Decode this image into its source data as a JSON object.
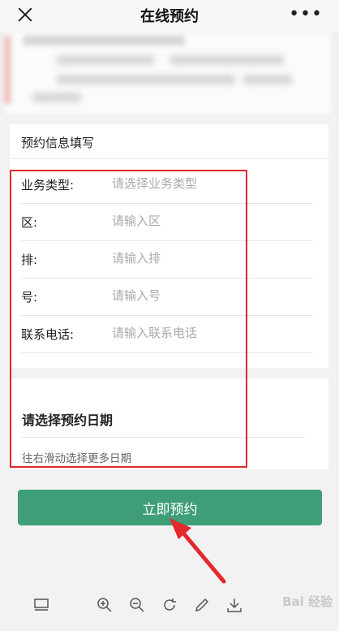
{
  "header": {
    "title": "在线预约"
  },
  "form": {
    "section_title": "预约信息填写",
    "fields": [
      {
        "label": "业务类型:",
        "placeholder": "请选择业务类型",
        "value": ""
      },
      {
        "label": "区:",
        "placeholder": "请输入区",
        "value": ""
      },
      {
        "label": "排:",
        "placeholder": "请输入排",
        "value": ""
      },
      {
        "label": "号:",
        "placeholder": "请输入号",
        "value": ""
      },
      {
        "label": "联系电话:",
        "placeholder": "请输入联系电话",
        "value": ""
      }
    ]
  },
  "date_section": {
    "title": "请选择预约日期",
    "hint": "往右滑动选择更多日期"
  },
  "submit_label": "立即预约",
  "colors": {
    "accent": "#3f9e78",
    "annotation_red": "#e2292b"
  },
  "toolbar": {
    "icons": [
      "layout-icon",
      "zoom-in-icon",
      "zoom-out-icon",
      "rotate-icon",
      "edit-icon",
      "download-icon"
    ]
  },
  "watermark": {
    "text": "Bai 经验"
  }
}
